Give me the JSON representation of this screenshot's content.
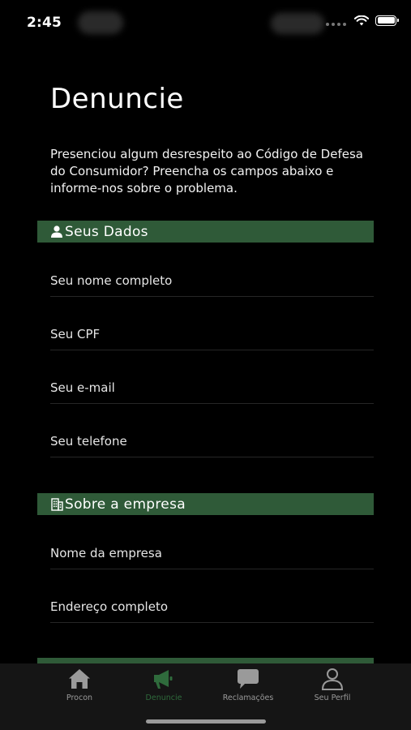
{
  "status_bar": {
    "time": "2:45"
  },
  "page": {
    "title": "Denuncie",
    "intro": "Presenciou algum desrespeito ao Código de Defesa do Consumidor? Preencha os campos abaixo e informe-nos sobre o problema."
  },
  "sections": {
    "personal": {
      "title": "Seus Dados",
      "icon": "user-icon",
      "fields": {
        "name": {
          "placeholder": "Seu nome completo",
          "value": ""
        },
        "cpf": {
          "placeholder": "Seu CPF",
          "value": ""
        },
        "email": {
          "placeholder": "Seu e-mail",
          "value": ""
        },
        "phone": {
          "placeholder": "Seu telefone",
          "value": ""
        }
      }
    },
    "company": {
      "title": "Sobre a empresa",
      "icon": "building-icon",
      "fields": {
        "company_name": {
          "placeholder": "Nome da empresa",
          "value": ""
        },
        "address": {
          "placeholder": "Endereço completo",
          "value": ""
        }
      }
    }
  },
  "tab_bar": {
    "active": "denuncie",
    "items": [
      {
        "id": "procon",
        "label": "Procon",
        "icon": "home-icon"
      },
      {
        "id": "denuncie",
        "label": "Denuncie",
        "icon": "megaphone-icon"
      },
      {
        "id": "reclamacoes",
        "label": "Reclamações",
        "icon": "chat-bubble-icon"
      },
      {
        "id": "perfil",
        "label": "Seu Perfil",
        "icon": "person-icon"
      }
    ]
  },
  "colors": {
    "background": "#000000",
    "section_header": "#2f5a38",
    "tab_active": "#2f6b3c",
    "tab_inactive": "#9a9a9a",
    "tab_bar_background": "#151515"
  }
}
